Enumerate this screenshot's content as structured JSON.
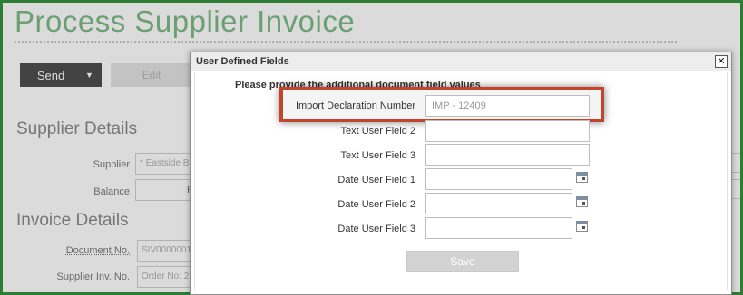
{
  "page": {
    "title": "Process Supplier Invoice",
    "toolbar": {
      "send_label": "Send",
      "edit_label": "Edit"
    },
    "supplier_details": {
      "heading": "Supplier Details",
      "supplier_label": "Supplier",
      "supplier_value": "* Eastside B",
      "balance_label": "Balance",
      "balance_value": "R"
    },
    "invoice_details": {
      "heading": "Invoice Details",
      "document_no_label": "Document No.",
      "document_no_value": "SIV0000001",
      "supplier_inv_no_label": "Supplier Inv. No.",
      "supplier_inv_no_value": "Order No: 2"
    }
  },
  "dialog": {
    "title": "User Defined Fields",
    "close_glyph": "✕",
    "instruction": "Please provide the additional document field values",
    "fields": [
      {
        "label": "Import Declaration Number",
        "value": "IMP - 12409",
        "type": "text"
      },
      {
        "label": "Text User Field 2",
        "value": "",
        "type": "text"
      },
      {
        "label": "Text User Field 3",
        "value": "",
        "type": "text"
      },
      {
        "label": "Date User Field 1",
        "value": "",
        "type": "date"
      },
      {
        "label": "Date User Field 2",
        "value": "",
        "type": "date"
      },
      {
        "label": "Date User Field 3",
        "value": "",
        "type": "date"
      }
    ],
    "save_label": "Save",
    "highlight_color": "#c0452b"
  }
}
